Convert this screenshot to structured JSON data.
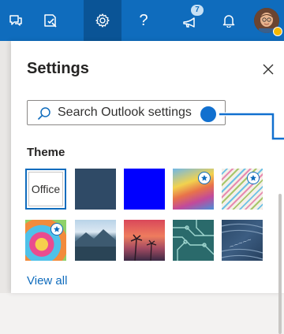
{
  "topbar": {
    "icons": [
      {
        "name": "chat-icon"
      },
      {
        "name": "tasks-icon"
      },
      {
        "name": "settings-icon",
        "active": true
      },
      {
        "name": "help-icon",
        "label": "?"
      },
      {
        "name": "megaphone-icon",
        "badge": "7"
      },
      {
        "name": "bell-icon"
      },
      {
        "name": "avatar"
      }
    ],
    "color": "#0f6cbd"
  },
  "settings_panel": {
    "title": "Settings",
    "close_icon": "close-icon",
    "search": {
      "placeholder": "Search Outlook settings",
      "icon": "search-icon"
    },
    "theme": {
      "section_title": "Theme",
      "tiles": [
        {
          "name": "theme-tile-office",
          "label": "Office",
          "selected": true,
          "starred": false
        },
        {
          "name": "theme-tile-dark-slate",
          "label": "",
          "color": "#2f4a66",
          "starred": false
        },
        {
          "name": "theme-tile-blue",
          "label": "",
          "color": "#0000ff",
          "starred": false
        },
        {
          "name": "theme-tile-rainbow-waves",
          "label": "",
          "starred": true
        },
        {
          "name": "theme-tile-color-lines",
          "label": "",
          "starred": true
        },
        {
          "name": "theme-tile-cartoon",
          "label": "",
          "starred": true
        },
        {
          "name": "theme-tile-mountain-lake",
          "label": "",
          "starred": false
        },
        {
          "name": "theme-tile-palm-sunset",
          "label": "",
          "starred": false
        },
        {
          "name": "theme-tile-circuit",
          "label": "",
          "starred": false
        },
        {
          "name": "theme-tile-stamp",
          "label": "",
          "starred": false
        }
      ]
    },
    "view_all": "View all"
  },
  "callout": {
    "color": "#1170cf"
  }
}
